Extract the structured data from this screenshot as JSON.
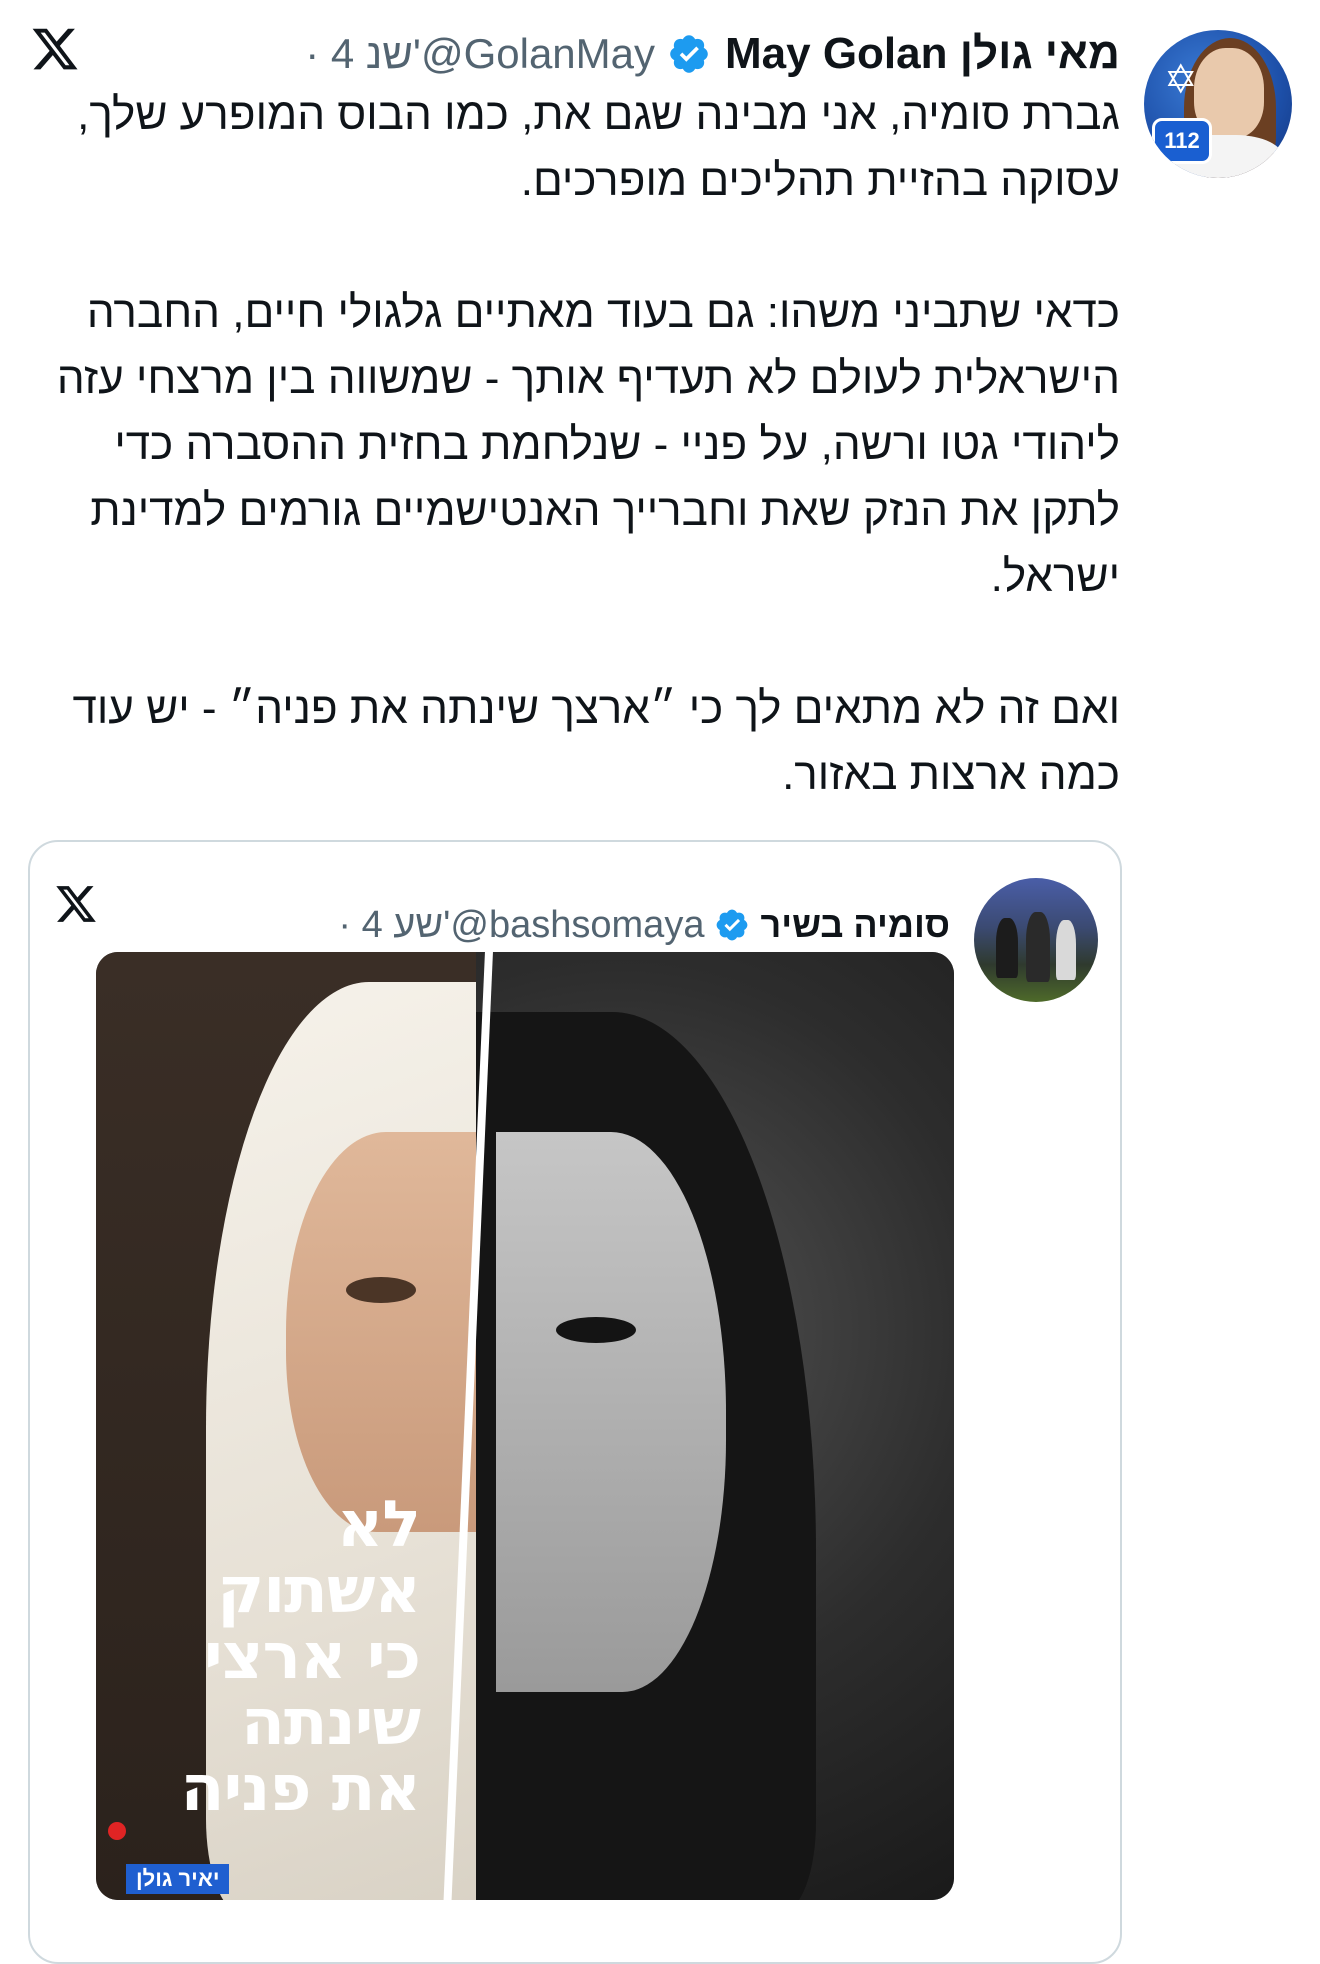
{
  "tweet": {
    "author": {
      "display_name": "May Golan מאי גולן",
      "handle": "@GolanMay",
      "time": "· 4 שנ'"
    },
    "paragraphs": [
      "גברת סומיה, אני מבינה שגם את, כמו הבוס המופרע שלך, עסוקה בהזיית תהליכים מופרכים.",
      "כדאי שתביני משהו: גם בעוד מאתיים גלגולי חיים, החברה הישראלית לעולם לא תעדיף אותך - שמשווה בין מרצחי עזה ליהודי גטו ורשה, על פניי - שנלחמת בחזית ההסברה כדי לתקן את הנזק שאת וחברייך האנטישמיים גורמים למדינת ישראל.",
      "ואם זה לא מתאים לך כי ״ארצך שינתה את פניה״ - יש עוד כמה ארצות באזור."
    ],
    "avatar_badge": "112"
  },
  "quoted": {
    "author": {
      "display_name": "סומיה בשיר",
      "handle": "@bashsomaya",
      "time": "· 4 שע'"
    },
    "poster": {
      "lines": [
        "לא",
        "אשתוק",
        "כי ארצי",
        "שינתה",
        "את פניה"
      ],
      "badge": "יאיר גולן"
    }
  },
  "colors": {
    "verified": "#1d9bf0",
    "secondary_text": "#536471",
    "border": "#cfd9de",
    "primary_text": "#0f1419"
  }
}
